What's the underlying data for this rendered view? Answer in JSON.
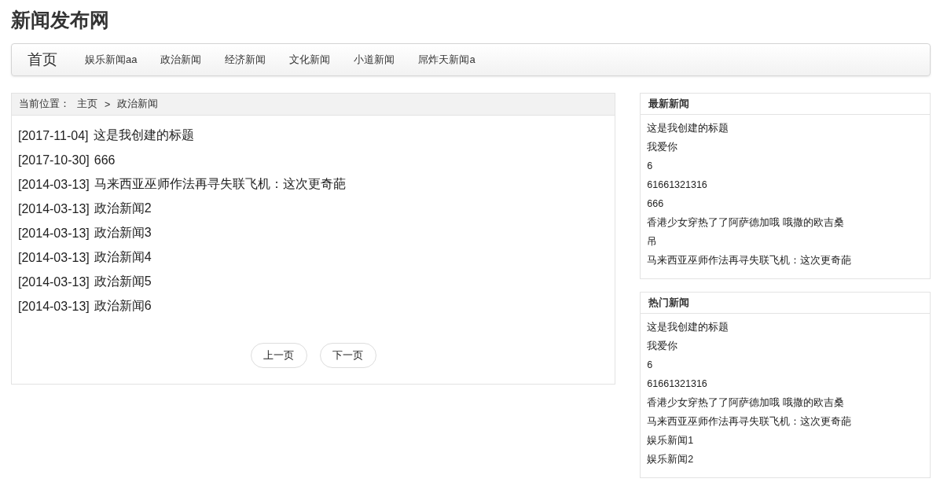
{
  "site_title": "新闻发布网",
  "nav": {
    "brand": "首页",
    "items": [
      "娱乐新闻aa",
      "政治新闻",
      "经济新闻",
      "文化新闻",
      "小道新闻",
      "屌炸天新闻a"
    ]
  },
  "breadcrumb": {
    "label": "当前位置：",
    "home": "主页",
    "separator": ">",
    "current": "政治新闻"
  },
  "articles": [
    {
      "date": "[2017-11-04]",
      "title": "这是我创建的标题"
    },
    {
      "date": "[2017-10-30]",
      "title": "666"
    },
    {
      "date": "[2014-03-13]",
      "title": "马来西亚巫师作法再寻失联飞机：这次更奇葩"
    },
    {
      "date": "[2014-03-13]",
      "title": "政治新闻2"
    },
    {
      "date": "[2014-03-13]",
      "title": "政治新闻3"
    },
    {
      "date": "[2014-03-13]",
      "title": "政治新闻4"
    },
    {
      "date": "[2014-03-13]",
      "title": "政治新闻5"
    },
    {
      "date": "[2014-03-13]",
      "title": "政治新闻6"
    }
  ],
  "pagination": {
    "prev": "上一页",
    "next": "下一页"
  },
  "sidebar": [
    {
      "title": "最新新闻",
      "items": [
        "这是我创建的标题",
        "我爱你",
        "6",
        "61661321316",
        "666",
        "香港少女穿热了了阿萨德加哦 哦撒的欧吉桑",
        "吊",
        "马来西亚巫师作法再寻失联飞机：这次更奇葩"
      ]
    },
    {
      "title": "热门新闻",
      "items": [
        "这是我创建的标题",
        "我爱你",
        "6",
        "61661321316",
        "香港少女穿热了了阿萨德加哦 哦撒的欧吉桑",
        "马来西亚巫师作法再寻失联飞机：这次更奇葩",
        "娱乐新闻1",
        "娱乐新闻2"
      ]
    }
  ]
}
